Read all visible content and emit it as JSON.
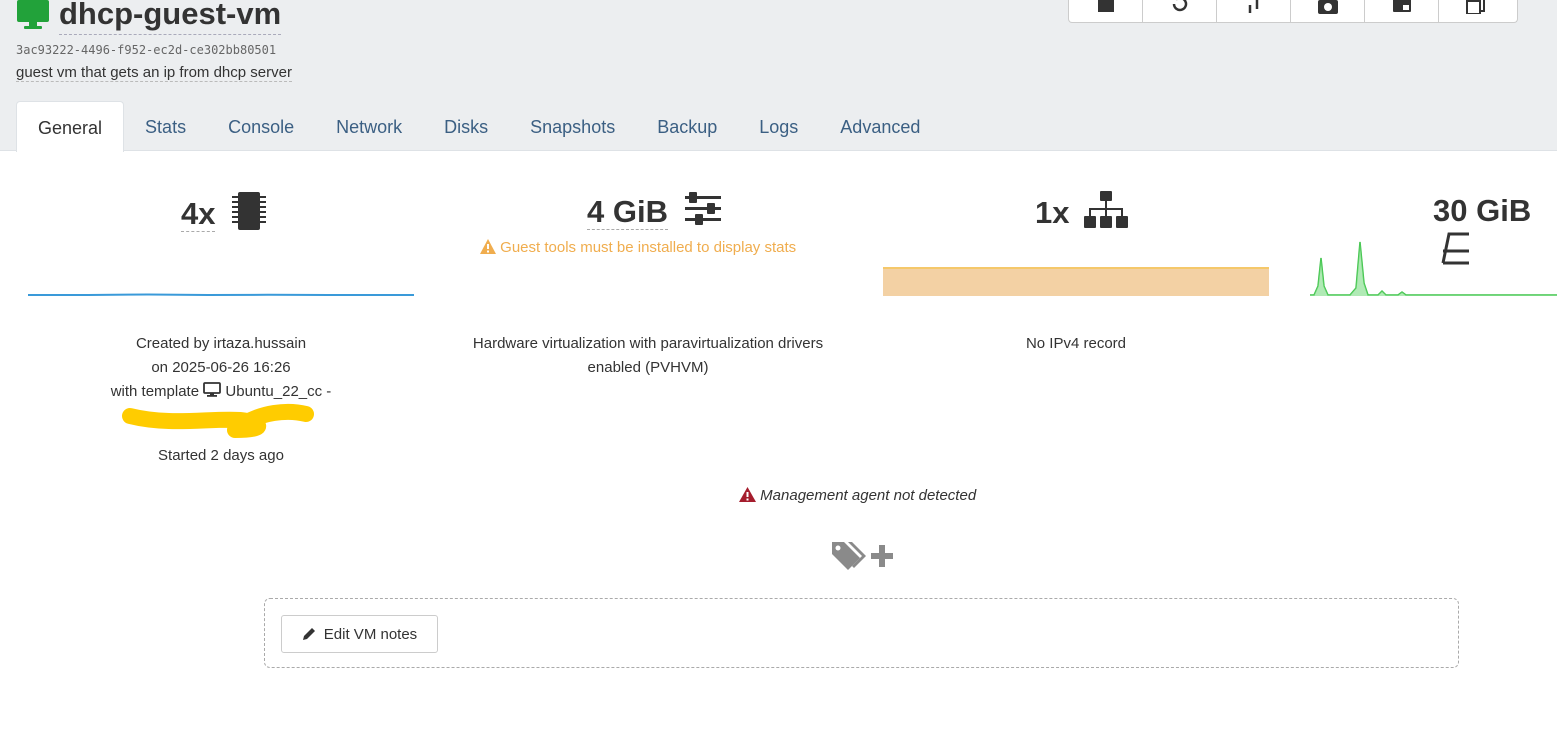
{
  "vm": {
    "name": "dhcp-guest-vm",
    "uuid": "3ac93222-4496-f952-ec2d-ce302bb80501",
    "description": "guest vm that gets an ip from dhcp server"
  },
  "toolbar": {
    "icons": [
      "stop-icon",
      "restart-icon",
      "migrate-icon",
      "snapshot-icon",
      "export-icon",
      "copy-icon"
    ]
  },
  "tabs": [
    "General",
    "Stats",
    "Console",
    "Network",
    "Disks",
    "Snapshots",
    "Backup",
    "Logs",
    "Advanced"
  ],
  "stats": {
    "cpu": {
      "value": "4x",
      "icon": "cpu-chip-icon"
    },
    "memory": {
      "value": "4 GiB",
      "icon": "sliders-icon",
      "warning": "Guest tools must be installed to display stats"
    },
    "network": {
      "value": "1x",
      "icon": "network-icon"
    },
    "disk": {
      "value": "30 GiB",
      "icon": "hdd-icon"
    }
  },
  "info": {
    "created_line1": "Created by irtaza.hussain",
    "created_line2": "on 2025-06-26 16:26",
    "template_prefix": "with template",
    "template_name": "Ubuntu_22_cc -",
    "started": "Started 2 days ago",
    "virtualization": "Hardware virtualization with paravirtualization drivers enabled (PVHVM)",
    "ipv4": "No IPv4 record"
  },
  "management_warning": "Management agent not detected",
  "notes_button": "Edit VM notes",
  "colors": {
    "accent": "#3b5f83",
    "vm_icon": "#22a23a",
    "warning": "#f0ad4e",
    "danger": "#a51d2d",
    "cpu_line": "#3a9ad9",
    "net_fill": "#f3d1a4",
    "disk_line": "#3fc34a",
    "scribble": "#ffcc00"
  }
}
